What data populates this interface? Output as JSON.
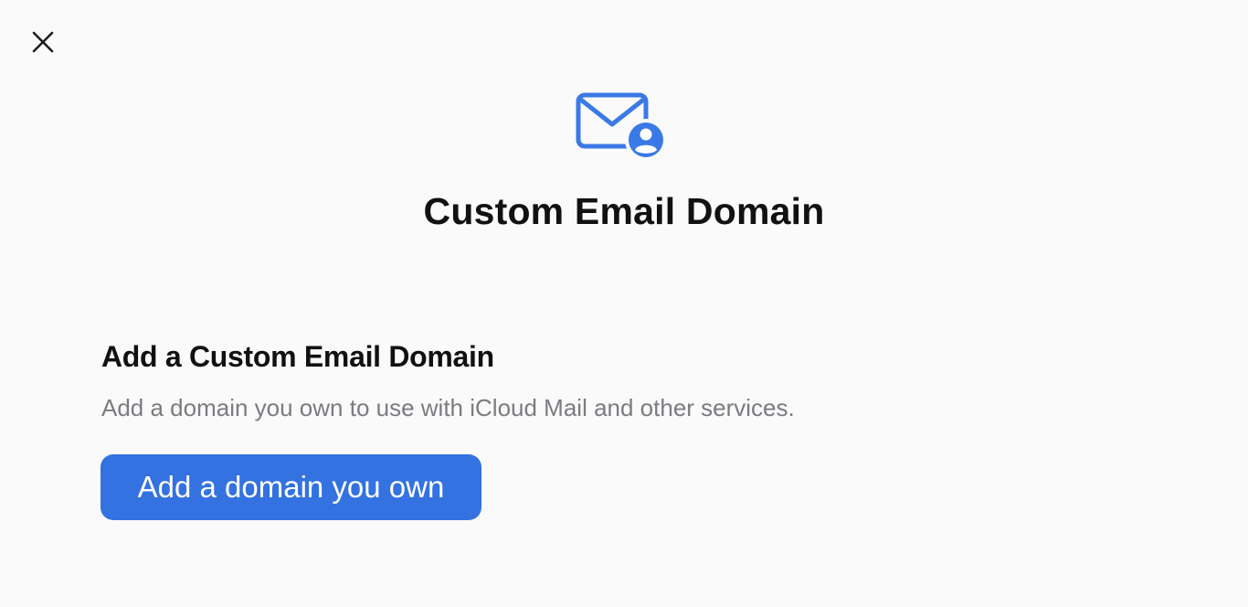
{
  "dialog": {
    "close_icon": "close-icon",
    "header_icon": "envelope-person-icon",
    "title": "Custom Email Domain"
  },
  "section": {
    "heading": "Add a Custom Email Domain",
    "description": "Add a domain you own to use with iCloud Mail and other services.",
    "button_label": "Add a domain you own"
  },
  "colors": {
    "background": "#fafafb",
    "accent": "#3372e0",
    "icon_blue": "#3b7ae6",
    "text_primary": "#111111",
    "text_secondary": "#7b7b80"
  }
}
